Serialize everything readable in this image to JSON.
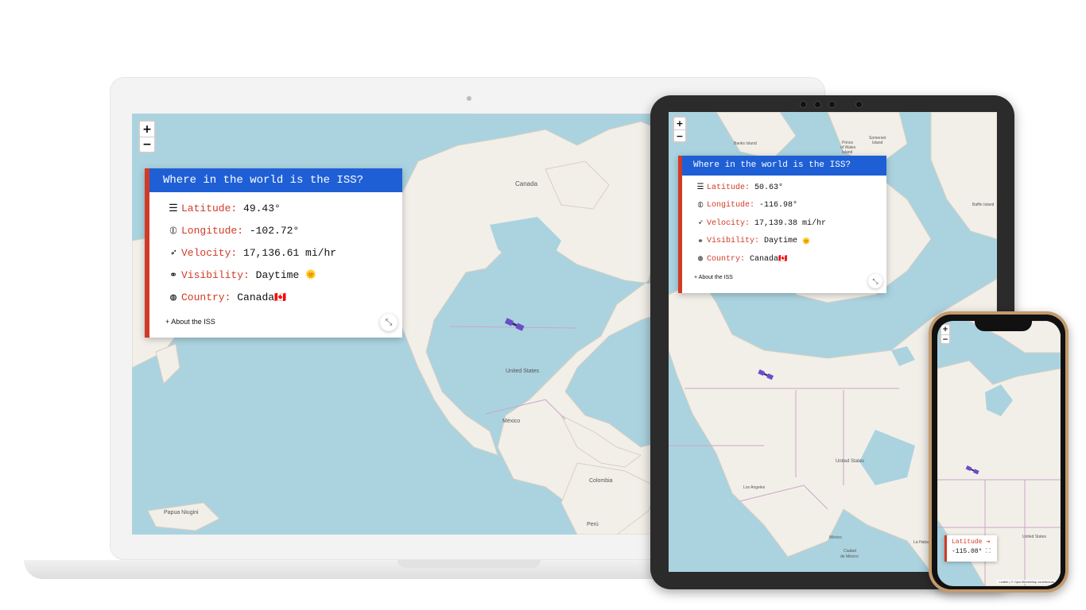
{
  "laptop": {
    "zoom_in": "+",
    "zoom_out": "−",
    "panel": {
      "title": "Where in the world is the ISS?",
      "latitude_label": "Latitude:",
      "latitude_value": "49.43°",
      "longitude_label": "Longitude:",
      "longitude_value": "-102.72°",
      "velocity_label": "Velocity:",
      "velocity_value": "17,136.61 mi/hr",
      "visibility_label": "Visibility:",
      "visibility_value": "Daytime",
      "visibility_icon": "🌞",
      "country_label": "Country:",
      "country_value": "Canada",
      "country_flag": "🇨🇦",
      "about": "+ About the ISS"
    },
    "map_labels": {
      "canada": "Canada",
      "united_states": "United States",
      "mexico": "México",
      "colombia": "Colombia",
      "papua": "Papua Niugini",
      "peru": "Perú"
    }
  },
  "tablet": {
    "zoom_in": "+",
    "zoom_out": "−",
    "panel": {
      "title": "Where in the world is the ISS?",
      "latitude_label": "Latitude:",
      "latitude_value": "50.63°",
      "longitude_label": "Longitude:",
      "longitude_value": "-116.98°",
      "velocity_label": "Velocity:",
      "velocity_value": "17,139.38 mi/hr",
      "visibility_label": "Visibility:",
      "visibility_value": "Daytime",
      "visibility_icon": "🌞",
      "country_label": "Country:",
      "country_value": "Canada",
      "country_flag": "🇨🇦",
      "about": "+ About the ISS"
    },
    "map_labels": {
      "banks": "Banks Island",
      "prince": "Prince",
      "of_wales": "of Wales",
      "island": "Island",
      "somerset": "Somerset",
      "somerset_island": "Island",
      "baffin": "Baffin Island",
      "united_states": "United States",
      "los_angeles": "Los Angeles",
      "mexico": "México",
      "ciudad": "Ciudad",
      "de_mexico": "de México",
      "la_habana": "La Haba"
    }
  },
  "phone": {
    "zoom_in": "+",
    "zoom_out": "−",
    "latitude_label": "Latitude",
    "latitude_value": "-115.08°",
    "attribution": "Leaflet | © OpenStreetMap contributors",
    "map_labels": {
      "united_states": "United States"
    }
  },
  "colors": {
    "accent_blue": "#1f5fd6",
    "accent_red": "#d13a26",
    "water": "#aad3df",
    "land": "#f2efe9"
  }
}
